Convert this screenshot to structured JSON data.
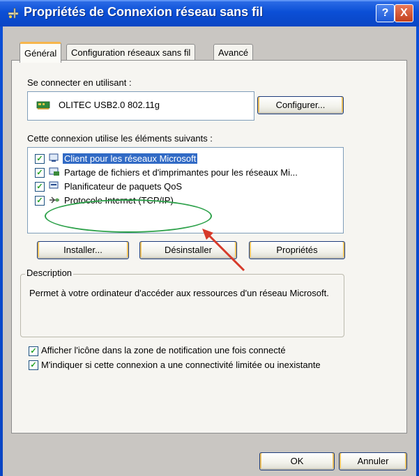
{
  "window": {
    "title": "Propriétés de Connexion réseau sans fil"
  },
  "titlebar_buttons": {
    "help": "?",
    "close": "X"
  },
  "tabs": [
    {
      "label": "Général",
      "active": true
    },
    {
      "label": "Configuration réseaux sans fil",
      "active": false
    },
    {
      "label": "Avancé",
      "active": false
    }
  ],
  "connect_using": {
    "label": "Se connecter en utilisant :",
    "adapter": "OLITEC USB2.0 802.11g",
    "configure_button": "Configurer..."
  },
  "components": {
    "label": "Cette connexion utilise les éléments suivants :",
    "items": [
      {
        "label": "Client pour les réseaux Microsoft",
        "checked": true,
        "selected": true
      },
      {
        "label": "Partage de fichiers et d'imprimantes pour les réseaux Mi...",
        "checked": true,
        "selected": false
      },
      {
        "label": "Planificateur de paquets QoS",
        "checked": true,
        "selected": false
      },
      {
        "label": "Protocole Internet (TCP/IP)",
        "checked": true,
        "selected": false
      }
    ],
    "highlight_color": "#2da14a",
    "arrow_color": "#d63a2a"
  },
  "actions": {
    "install": "Installer...",
    "uninstall": "Désinstaller",
    "properties": "Propriétés"
  },
  "description": {
    "legend": "Description",
    "text": "Permet à votre ordinateur d'accéder aux ressources d'un réseau Microsoft."
  },
  "options": {
    "show_icon": {
      "label": "Afficher l'icône dans la zone de notification une fois connecté",
      "checked": true
    },
    "notify_limited": {
      "label": "M'indiquer si cette connexion a une connectivité limitée ou inexistante",
      "checked": true
    }
  },
  "footer": {
    "ok": "OK",
    "cancel": "Annuler"
  },
  "colors": {
    "titlebar": "#0b4fd6",
    "selection": "#316ac5",
    "tab_accent": "#f7b64b"
  }
}
